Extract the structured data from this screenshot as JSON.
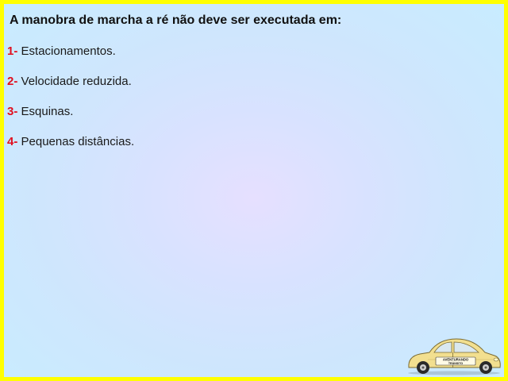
{
  "question": "A manobra de marcha a ré não deve ser executada em:",
  "options": [
    {
      "number": "1-",
      "text": "Estacionamentos."
    },
    {
      "number": "2-",
      "text": "Velocidade reduzida."
    },
    {
      "number": "3-",
      "text": "Esquinas."
    },
    {
      "number": "4-",
      "text": "Pequenas distâncias."
    }
  ],
  "logo": {
    "icon": "car-icon",
    "door_text_line1": "AVENTURANDO",
    "door_text_line2": "TRÂNSITO"
  },
  "colors": {
    "border": "#ffff00",
    "number": "#e01020",
    "text": "#1a1a1a",
    "car_body": "#f2df8f"
  }
}
